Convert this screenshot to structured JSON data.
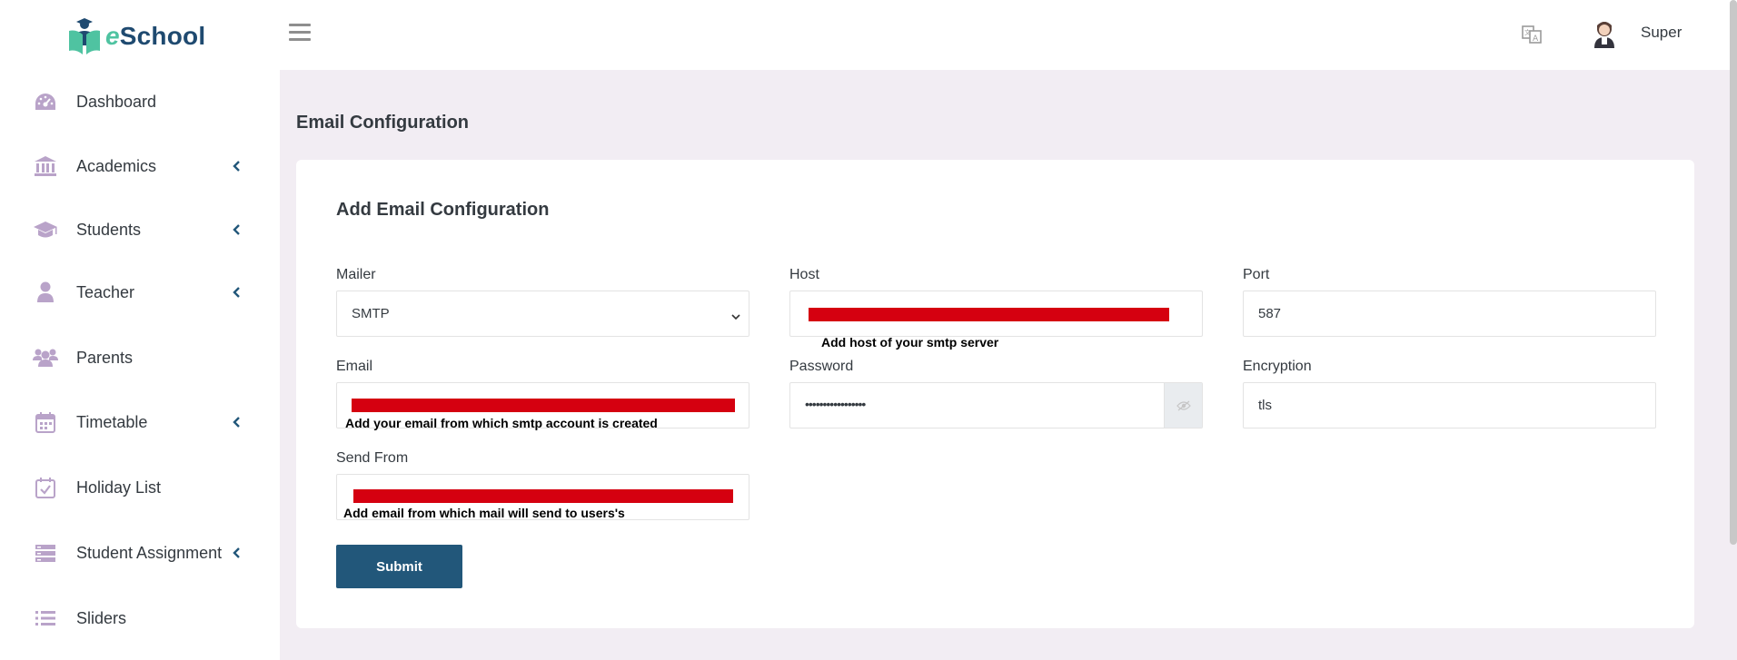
{
  "brand": {
    "name_prefix": "e",
    "name_rest": "School"
  },
  "sidebar": {
    "items": [
      {
        "label": "Dashboard",
        "icon": "dashboard-icon",
        "has_submenu": false
      },
      {
        "label": "Academics",
        "icon": "bank-icon",
        "has_submenu": true
      },
      {
        "label": "Students",
        "icon": "graduation-cap-icon",
        "has_submenu": true
      },
      {
        "label": "Teacher",
        "icon": "user-icon",
        "has_submenu": true
      },
      {
        "label": "Parents",
        "icon": "users-icon",
        "has_submenu": false
      },
      {
        "label": "Timetable",
        "icon": "calendar-icon",
        "has_submenu": true
      },
      {
        "label": "Holiday List",
        "icon": "calendar-check-icon",
        "has_submenu": false
      },
      {
        "label": "Student Assignment",
        "icon": "stack-icon",
        "has_submenu": true
      },
      {
        "label": "Sliders",
        "icon": "list-icon",
        "has_submenu": false
      }
    ]
  },
  "topbar": {
    "user_name": "Super"
  },
  "page": {
    "title": "Email Configuration"
  },
  "form": {
    "title": "Add Email Configuration",
    "mailer": {
      "label": "Mailer",
      "value": "SMTP"
    },
    "host": {
      "label": "Host",
      "helper": "Add host of your smtp server"
    },
    "port": {
      "label": "Port",
      "value": "587"
    },
    "email": {
      "label": "Email",
      "helper": "Add your email from which smtp account is created"
    },
    "password": {
      "label": "Password",
      "value": "•••••••••••••••••"
    },
    "encryption": {
      "label": "Encryption",
      "value": "tls"
    },
    "send_from": {
      "label": "Send From",
      "helper": "Add email from which mail will send  to users's"
    },
    "submit_label": "Submit"
  },
  "colors": {
    "accent": "#22577a",
    "sidebar_icon": "#b9a3c9",
    "redaction": "#d50010",
    "background": "#f2edf3"
  }
}
